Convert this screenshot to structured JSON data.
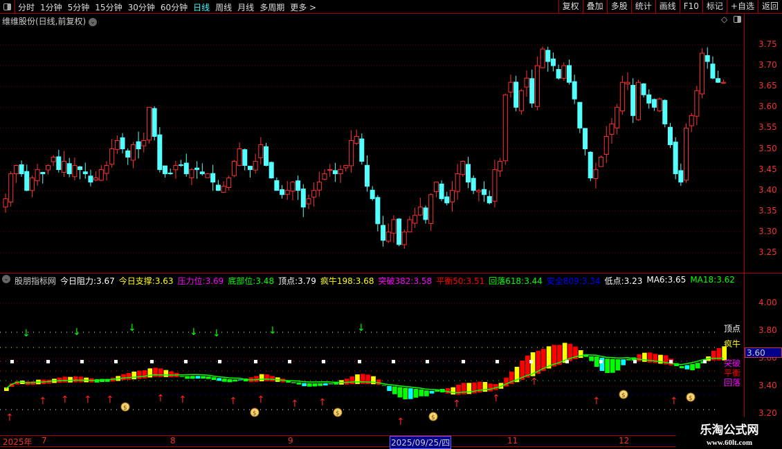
{
  "toolbar": {
    "periods": [
      "分时",
      "1分钟",
      "5分钟",
      "15分钟",
      "30分钟",
      "60分钟",
      "日线",
      "周线",
      "月线",
      "多周期",
      "更多 >"
    ],
    "active": "日线",
    "buttons": [
      "复权",
      "叠加",
      "多股",
      "统计",
      "画线",
      "F10",
      "标记",
      "+自选",
      "返回"
    ]
  },
  "chart": {
    "title": "维维股份(日线,前复权)",
    "price_ticks": [
      "3.75",
      "3.70",
      "3.65",
      "3.60",
      "3.55",
      "3.50",
      "3.45",
      "3.40",
      "3.35",
      "3.30",
      "3.25"
    ],
    "closes": [
      3.38,
      3.44,
      3.46,
      3.44,
      3.4,
      3.43,
      3.45,
      3.44,
      3.46,
      3.48,
      3.45,
      3.47,
      3.44,
      3.46,
      3.45,
      3.44,
      3.42,
      3.43,
      3.45,
      3.46,
      3.5,
      3.52,
      3.5,
      3.48,
      3.51,
      3.5,
      3.52,
      3.6,
      3.53,
      3.45,
      3.44,
      3.44,
      3.46,
      3.46,
      3.44,
      3.45,
      3.45,
      3.44,
      3.44,
      3.42,
      3.4,
      3.41,
      3.43,
      3.47,
      3.5,
      3.46,
      3.45,
      3.47,
      3.51,
      3.46,
      3.43,
      3.4,
      3.39,
      3.4,
      3.42,
      3.4,
      3.36,
      3.38,
      3.4,
      3.42,
      3.44,
      3.45,
      3.44,
      3.45,
      3.46,
      3.52,
      3.53,
      3.47,
      3.41,
      3.38,
      3.32,
      3.28,
      3.3,
      3.33,
      3.27,
      3.3,
      3.33,
      3.34,
      3.36,
      3.33,
      3.39,
      3.42,
      3.38,
      3.37,
      3.4,
      3.44,
      3.47,
      3.42,
      3.4,
      3.4,
      3.39,
      3.37,
      3.45,
      3.47,
      3.63,
      3.66,
      3.6,
      3.64,
      3.67,
      3.61,
      3.7,
      3.74,
      3.71,
      3.7,
      3.67,
      3.7,
      3.66,
      3.62,
      3.55,
      3.5,
      3.43,
      3.45,
      3.48,
      3.53,
      3.56,
      3.6,
      3.66,
      3.66,
      3.58,
      3.66,
      3.63,
      3.61,
      3.6,
      3.62,
      3.56,
      3.51,
      3.44,
      3.42,
      3.55,
      3.58,
      3.64,
      3.73,
      3.71,
      3.67,
      3.66,
      3.66
    ]
  },
  "indicator": {
    "name": "股朋指标网",
    "items": [
      {
        "label": "今日阻力:",
        "value": "3.67",
        "color": "#ffffff"
      },
      {
        "label": "今日支撑:",
        "value": "3.63",
        "color": "#ffff00"
      },
      {
        "label": "压力位:",
        "value": "3.69",
        "color": "#ff00ff"
      },
      {
        "label": "底部位:",
        "value": "3.48",
        "color": "#00ff00"
      },
      {
        "label": "顶点:",
        "value": "3.79",
        "color": "#ffffff"
      },
      {
        "label": "疯牛198:",
        "value": "3.68",
        "color": "#ffff00"
      },
      {
        "label": "突破382:",
        "value": "3.58",
        "color": "#ff00ff"
      },
      {
        "label": "平衡50:",
        "value": "3.51",
        "color": "#ff0000"
      },
      {
        "label": "回落618:",
        "value": "3.44",
        "color": "#00ff00"
      },
      {
        "label": "安全809:",
        "value": "3.34",
        "color": "#0000ff"
      },
      {
        "label": "低点:",
        "value": "3.23",
        "color": "#ffffff"
      },
      {
        "label": "MA6:",
        "value": "3.65",
        "color": "#ffffff"
      },
      {
        "label": "MA18:",
        "value": "3.62",
        "color": "#00ff00"
      }
    ],
    "ticks": [
      "4.00",
      "3.80",
      "3.60",
      "3.40",
      "3.20"
    ],
    "current": "3.60",
    "line_labels": [
      {
        "text": "顶点",
        "color": "#ffffff"
      },
      {
        "text": "疯牛",
        "color": "#ffff00"
      },
      {
        "text": "突破",
        "color": "#ff00ff"
      },
      {
        "text": "平衡",
        "color": "#ff0000"
      },
      {
        "text": "回落",
        "color": "#ff00ff"
      }
    ]
  },
  "xaxis": {
    "labels": [
      "2025年",
      "7",
      "8",
      "9",
      "11",
      "12"
    ],
    "cursor": "2025/09/25/四"
  },
  "watermark": {
    "name": "乐淘公式网",
    "url": "www.60lt.com"
  }
}
